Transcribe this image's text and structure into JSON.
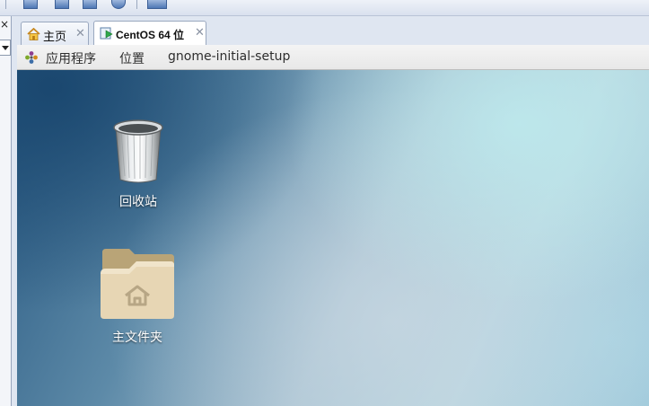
{
  "toolbar": {
    "icons": [
      "window-icon",
      "display-icon",
      "fullscreen-icon",
      "vm-info-icon",
      "console-icon"
    ]
  },
  "sidebar": {
    "close_glyph": "×"
  },
  "tabs": [
    {
      "label": "主页",
      "icon": "home-icon",
      "close_glyph": "✕"
    },
    {
      "label": "CentOS 64 位",
      "icon": "vm-run-icon",
      "close_glyph": "✕",
      "active": true
    }
  ],
  "gnome_bar": {
    "applications": "应用程序",
    "places": "位置",
    "app_name": "gnome-initial-setup"
  },
  "desktop": {
    "trash_label": "回收站",
    "home_folder_label": "主文件夹"
  },
  "colors": {
    "tab_border": "#9aa8bf",
    "gnome_bar_bg": "#f0f0f0",
    "desktop_dark": "#2a5a82",
    "desktop_light": "#b9d7e0"
  }
}
